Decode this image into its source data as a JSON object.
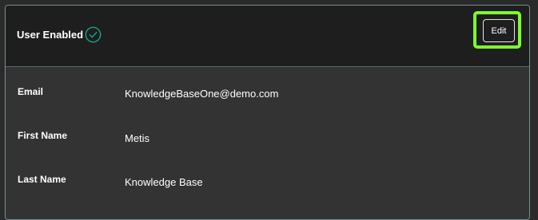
{
  "header": {
    "status_label": "User Enabled",
    "status_icon": "check-circle-icon",
    "edit_label": "Edit"
  },
  "fields": [
    {
      "label": "Email",
      "value": "KnowledgeBaseOne@demo.com"
    },
    {
      "label": "First Name",
      "value": "Metis"
    },
    {
      "label": "Last Name",
      "value": "Knowledge Base"
    }
  ],
  "colors": {
    "status_check": "#17a589",
    "highlight": "#7fff2a"
  }
}
